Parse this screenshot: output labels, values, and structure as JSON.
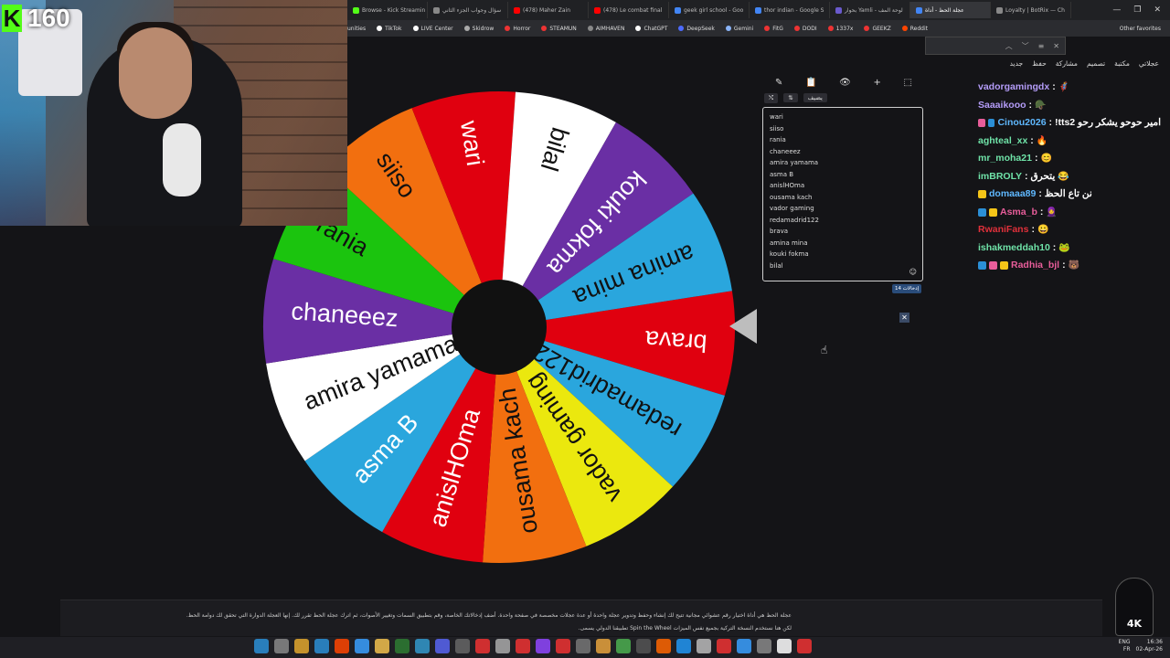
{
  "browser": {
    "tabs": [
      {
        "label": "Browse - Kick Streamin",
        "color": "#53fc18"
      },
      {
        "label": "سؤال وجواب الجزء الثاني",
        "color": "#888"
      },
      {
        "label": "(478) Maher Zain",
        "color": "#ff0000"
      },
      {
        "label": "(478) Le combat final",
        "color": "#ff0000"
      },
      {
        "label": "geek girl school - Goo",
        "color": "#4285f4"
      },
      {
        "label": "thor indian - Google S",
        "color": "#4285f4"
      },
      {
        "label": "بحوار Yamli - لوحة المف",
        "color": "#6a5acd"
      },
      {
        "label": "عجلة الحظ - أداة",
        "color": "#4285f4",
        "active": true
      },
      {
        "label": "Loyalty | BotRix — Ch",
        "color": "#888"
      }
    ],
    "window_controls": [
      "—",
      "❐",
      "✕"
    ],
    "bookmarks": [
      {
        "label": "TikTok",
        "color": "#fff"
      },
      {
        "label": "LIVE Center",
        "color": "#fff"
      },
      {
        "label": "Skidrow",
        "color": "#aaa"
      },
      {
        "label": "Horror",
        "color": "#e33"
      },
      {
        "label": "STEAMUN",
        "color": "#e33"
      },
      {
        "label": "AIMHAVEN",
        "color": "#888"
      },
      {
        "label": "ChatGPT",
        "color": "#fff"
      },
      {
        "label": "DeepSeek",
        "color": "#4d6bfe"
      },
      {
        "label": "Gemini",
        "color": "#8ab4f8"
      },
      {
        "label": "FitG",
        "color": "#e33"
      },
      {
        "label": "DODI",
        "color": "#e33"
      },
      {
        "label": "1337x",
        "color": "#e33"
      },
      {
        "label": "GEEKZ",
        "color": "#e33"
      },
      {
        "label": "Reddit",
        "color": "#ff4500"
      }
    ],
    "bookmarks_left_stub": "unities",
    "other_favorites": "Other favorites",
    "find_icons": [
      "︿",
      "﹀",
      "≡",
      "✕"
    ]
  },
  "app_toolbar": [
    "عجلاتي",
    "مكتبة",
    "تصميم",
    "مشاركة",
    "حفظ",
    "جديد"
  ],
  "stream": {
    "viewer_count": "160",
    "platform_letter": "K"
  },
  "wheel": {
    "center_color": "#111111",
    "segments": [
      {
        "label": "brava",
        "color": "#e0000f",
        "text": "#ffffff"
      },
      {
        "label": "redamadrid122",
        "color": "#2aa6dd",
        "text": "#111111"
      },
      {
        "label": "vador gaming",
        "color": "#ebe80e",
        "text": "#111111"
      },
      {
        "label": "ousama kach",
        "color": "#f26f0f",
        "text": "#111111"
      },
      {
        "label": "anislHOma",
        "color": "#e0000f",
        "text": "#ffffff"
      },
      {
        "label": "asma B",
        "color": "#2aa6dd",
        "text": "#ffffff"
      },
      {
        "label": "amira yamama",
        "color": "#ffffff",
        "text": "#111111"
      },
      {
        "label": "chaneeez",
        "color": "#6a2fa4",
        "text": "#ffffff"
      },
      {
        "label": "rania",
        "color": "#1bc40e",
        "text": "#111111"
      },
      {
        "label": "siiso",
        "color": "#f26f0f",
        "text": "#111111"
      },
      {
        "label": "wari",
        "color": "#e0000f",
        "text": "#ffffff"
      },
      {
        "label": "bilal",
        "color": "#ffffff",
        "text": "#111111"
      },
      {
        "label": "kouki fokma",
        "color": "#6a2fa4",
        "text": "#ffffff"
      },
      {
        "label": "amina mina",
        "color": "#2aa6dd",
        "text": "#111111"
      }
    ]
  },
  "editor": {
    "tool_icons": [
      "✎",
      "📋",
      "👁",
      "+",
      "⬚"
    ],
    "shuffle_icon": "⤭",
    "sort_icon": "⇅",
    "add_image_label": "يضيف",
    "entries": [
      "wari",
      "siiso",
      "rania",
      "chaneeez",
      "amira yamama",
      "asma B",
      "anislHOma",
      "ousama kach",
      "vador gaming",
      "redamadrid122",
      "brava",
      "amina mina",
      "kouki fokma",
      "bilal"
    ],
    "entry_count_label": "إدخالات 14",
    "close_label": "✕"
  },
  "chat": [
    {
      "user": "vadorgamingdx",
      "color": "#b49cf8",
      "text": ":",
      "emo": "🦸"
    },
    {
      "user": "Saaaikooo",
      "color": "#b49cf8",
      "text": ":",
      "emo": "🪖"
    },
    {
      "user": "Cinou2026",
      "color": "#5fb8ff",
      "text": ": !tts2 امير حوحو يشكر رحو",
      "emo": "",
      "badges": [
        "#e85d9a",
        "#2b8fd6"
      ]
    },
    {
      "user": "aghteal_xx",
      "color": "#6fe3a8",
      "text": ":",
      "emo": "🔥"
    },
    {
      "user": "mr_moha21",
      "color": "#6fe3a8",
      "text": ":",
      "emo": "😊"
    },
    {
      "user": "imBROLY",
      "color": "#6fe3a8",
      "text": ": يتحرق",
      "emo": "😂"
    },
    {
      "user": "domaaa89",
      "color": "#5fb8ff",
      "text": ": نن تاع الحظ",
      "emo": "",
      "badges": [
        "#f5c518"
      ]
    },
    {
      "user": "Asma_b",
      "color": "#e85d9a",
      "text": ":",
      "emo": "🧕",
      "badges": [
        "#2b8fd6",
        "#f5c518"
      ]
    },
    {
      "user": "RwaniFans",
      "color": "#e0303a",
      "text": ":",
      "emo": "😀"
    },
    {
      "user": "ishakmeddah10",
      "color": "#6fe3a8",
      "text": ":",
      "emo": "🐸"
    },
    {
      "user": "Radhia_bjl",
      "color": "#e85d9a",
      "text": ":",
      "emo": "🐻",
      "badges": [
        "#2b8fd6",
        "#e85d9a",
        "#f5c518"
      ]
    }
  ],
  "description": {
    "line1": "عجلة الحظ هي أداة اختيار رقم عشوائي مجانية تتيح لك إنشاء وحفظ وتدوير عجلة واحدة أو عدة عجلات مخصصة في صفحة واحدة. أضف إدخالاتك الخاصة، وقم بتطبيق السمات وتغيير الأصوات، ثم اترك عجلة الحظ تقرر لك. إنها العجلة الدوارة التي تحقق لك دوامة الحظ.",
    "line2": "لكن هنا نستخدم النسخة التركية بجميع نفس الميزات Spin the Wheel تطبيقنا الدولي يسمى."
  },
  "logo": "4K",
  "taskbar": {
    "lang_top": "ENG",
    "lang_bottom": "FR",
    "time": "16:36",
    "date": "02-Apr-26",
    "icons": [
      "#2b8fd6",
      "#888",
      "#e2a72e",
      "#2b8fd6",
      "#ff4500",
      "#3aa0ff",
      "#f2c14e",
      "#2e7d32",
      "#39c",
      "#5865f2",
      "#666",
      "#e33",
      "#aaa",
      "#e33",
      "#9147ff",
      "#e33",
      "#777",
      "#e8a33d",
      "#4caf50",
      "#555",
      "#ff6600",
      "#2196f3",
      "#bbb",
      "#e33",
      "#3aa0ff",
      "#888",
      "#fff",
      "#e33"
    ]
  }
}
